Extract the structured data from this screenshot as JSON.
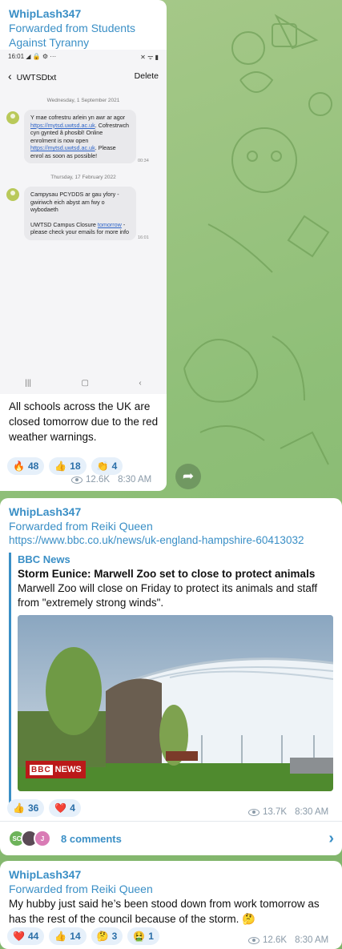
{
  "messages": [
    {
      "sender": "WhipLash347",
      "forwarded_from": "Forwarded from Students Against Tyranny",
      "forwarded_line1": "Forwarded from Students",
      "forwarded_line2": "Against Tyranny",
      "screenshot": {
        "status_time": "16:01",
        "status_icons": "◢ 🔒 ⚙ ···",
        "status_right": "✕ ᯤ ▮",
        "conversation_title": "UWTSDtxt",
        "delete_label": "Delete",
        "sms": [
          {
            "date": "Wednesday, 1 September 2021",
            "line_a": "Y mae cofrestru arlein yn awr ar agor ",
            "link_a": "https://mytsd.uwtsd.ac.uk",
            "line_b": ". Cofrestrwch cyn gynted â phosibl! Online enrolment is now open ",
            "link_b": "https://mytsd.uwtsd.ac.uk",
            "line_c": ". Please enrol as soon as possible!",
            "time": "00:34"
          },
          {
            "date": "Thursday, 17 February 2022",
            "line_a": "Campysau PCYDDS ar gau yfory - gwiriwch eich abyst am fwy o wybodaeth",
            "line_b": "UWTSD Campus Closure ",
            "link": "tomorrow",
            "line_c": " - please check your emails for more info",
            "time": "16:01"
          }
        ],
        "nav_recent": "|||",
        "nav_home": "▢",
        "nav_back": "‹"
      },
      "text": "All schools across the UK are closed tomorrow due to the red weather warnings.",
      "reactions": [
        {
          "emoji": "🔥",
          "count": "48"
        },
        {
          "emoji": "👍",
          "count": "18"
        },
        {
          "emoji": "👏",
          "count": "4"
        }
      ],
      "views": "12.6K",
      "time": "8:30 AM"
    },
    {
      "sender": "WhipLash347",
      "forwarded_from": "Forwarded from Reiki Queen",
      "link": "https://www.bbc.co.uk/news/uk-england-hampshire-60413032",
      "preview": {
        "site": "BBC News",
        "title": "Storm Eunice: Marwell Zoo set to close to protect animals",
        "description": "Marwell Zoo will close on Friday to protect its animals and staff from \"extremely strong winds\".",
        "logo_bbc": "BBC",
        "logo_news": "NEWS"
      },
      "reactions": [
        {
          "emoji": "👍",
          "count": "36"
        },
        {
          "emoji": "❤️",
          "count": "4"
        }
      ],
      "views": "13.7K",
      "time": "8:30 AM",
      "comments": {
        "avatars": [
          "SC",
          "",
          "J"
        ],
        "label": "8 comments"
      }
    },
    {
      "sender": "WhipLash347",
      "forwarded_from": "Forwarded from Reiki Queen",
      "text": "My hubby just said he’s been stood down from work tomorrow as has the rest of the council because of the storm. 🤔",
      "reactions": [
        {
          "emoji": "❤️",
          "count": "44"
        },
        {
          "emoji": "👍",
          "count": "14"
        },
        {
          "emoji": "🤔",
          "count": "3"
        },
        {
          "emoji": "🤮",
          "count": "1"
        }
      ],
      "views": "12.6K",
      "time": "8:30 AM"
    }
  ],
  "colors": {
    "accent": "#3a8fc6",
    "reaction_bg": "#e6f0fa",
    "chat_bg": "#8fbf78"
  }
}
